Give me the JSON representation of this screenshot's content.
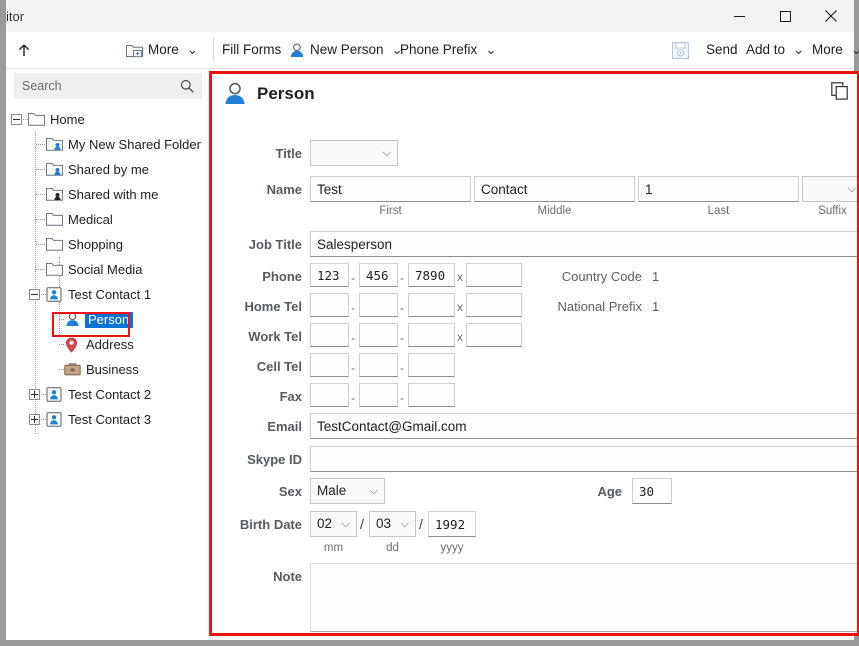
{
  "window": {
    "title": "itor",
    "minimize_label": "Minimize",
    "maximize_label": "Maximize",
    "close_label": "Close"
  },
  "toolbar": {
    "up_icon": "up-arrow-icon",
    "new_folder_icon": "new-folder-icon",
    "more_left_label": "More",
    "fill_forms_label": "Fill Forms",
    "new_person_label": "New Person",
    "new_person_icon": "person-icon",
    "phone_prefix_label": "Phone Prefix",
    "save_icon": "save-disk-icon",
    "send_label": "Send",
    "add_to_label": "Add to",
    "more_right_label": "More",
    "chevron": "⌄"
  },
  "sidebar": {
    "search": {
      "placeholder": "Search",
      "value": "",
      "icon": "search-icon"
    },
    "tree": [
      {
        "label": "Home",
        "icon": "folder-icon",
        "depth": 0,
        "expander": "minus",
        "selected": false
      },
      {
        "label": "My New Shared Folder",
        "icon": "shared-folder-icon",
        "depth": 1,
        "expander": "none",
        "selected": false
      },
      {
        "label": "Shared by me",
        "icon": "shared-folder-icon",
        "depth": 1,
        "expander": "none",
        "selected": false
      },
      {
        "label": "Shared with me",
        "icon": "shared-folder-dark-icon",
        "depth": 1,
        "expander": "none",
        "selected": false
      },
      {
        "label": "Medical",
        "icon": "folder-icon",
        "depth": 1,
        "expander": "none",
        "selected": false
      },
      {
        "label": "Shopping",
        "icon": "folder-icon",
        "depth": 1,
        "expander": "none",
        "selected": false
      },
      {
        "label": "Social Media",
        "icon": "folder-icon",
        "depth": 1,
        "expander": "none",
        "selected": false
      },
      {
        "label": "Test Contact 1",
        "icon": "contact-card-icon",
        "depth": 1,
        "expander": "minus",
        "selected": false
      },
      {
        "label": "Person",
        "icon": "person-icon",
        "depth": 2,
        "expander": "none",
        "selected": true
      },
      {
        "label": "Address",
        "icon": "map-pin-icon",
        "depth": 2,
        "expander": "none",
        "selected": false
      },
      {
        "label": "Business",
        "icon": "briefcase-icon",
        "depth": 2,
        "expander": "none",
        "selected": false
      },
      {
        "label": "Test Contact 2",
        "icon": "contact-card-icon",
        "depth": 1,
        "expander": "plus",
        "selected": false
      },
      {
        "label": "Test Contact 3",
        "icon": "contact-card-icon",
        "depth": 1,
        "expander": "plus",
        "selected": false
      }
    ]
  },
  "form": {
    "header_title": "Person",
    "header_icon": "person-icon",
    "copy_icon": "copy-icon",
    "labels": {
      "title": "Title",
      "name": "Name",
      "job_title": "Job Title",
      "phone": "Phone",
      "home_tel": "Home Tel",
      "work_tel": "Work Tel",
      "cell_tel": "Cell Tel",
      "fax": "Fax",
      "email": "Email",
      "skype": "Skype ID",
      "sex": "Sex",
      "age": "Age",
      "birth_date": "Birth Date",
      "note": "Note"
    },
    "sublabels": {
      "first": "First",
      "middle": "Middle",
      "last": "Last",
      "suffix": "Suffix",
      "mm": "mm",
      "dd": "dd",
      "yyyy": "yyyy"
    },
    "values": {
      "title": "",
      "name_first": "Test",
      "name_middle": "Contact",
      "name_last": "1",
      "name_suffix": "",
      "job_title": "Salesperson",
      "phone_1": "123",
      "phone_2": "456",
      "phone_3": "7890",
      "phone_ext": "",
      "home_tel_1": "",
      "home_tel_2": "",
      "home_tel_3": "",
      "home_tel_ext": "",
      "work_tel_1": "",
      "work_tel_2": "",
      "work_tel_3": "",
      "work_tel_ext": "",
      "cell_tel_1": "",
      "cell_tel_2": "",
      "cell_tel_3": "",
      "fax_1": "",
      "fax_2": "",
      "fax_3": "",
      "email": "TestContact@Gmail.com",
      "skype": "",
      "sex": "Male",
      "age": "30",
      "birth_mm": "02",
      "birth_dd": "03",
      "birth_yyyy": "1992",
      "note": ""
    },
    "side": {
      "country_code_label": "Country Code",
      "country_code_value": "1",
      "national_prefix_label": "National Prefix",
      "national_prefix_value": "1"
    },
    "separators": {
      "dash": "-",
      "ext": "x",
      "slash": "/"
    }
  },
  "colors": {
    "accent_blue": "#0c72d4",
    "highlight_red": "#ee1111",
    "label_gray": "#555b61",
    "window_frame": "#9a9a9a"
  }
}
